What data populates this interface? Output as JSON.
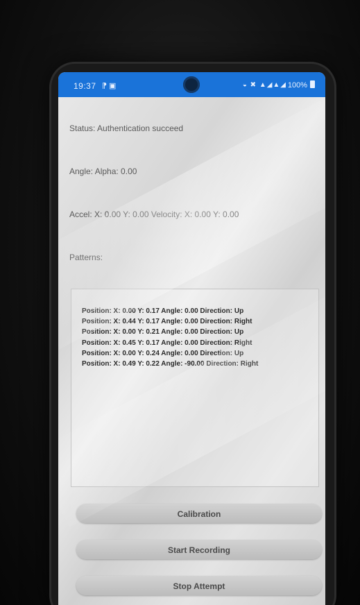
{
  "status_bar": {
    "time": "19:37",
    "left_icons": "⁋ ▣",
    "right_icons": "◒ ✖ ▲◢▲◢",
    "battery": "100%"
  },
  "status": {
    "label": "Status: Authentication succeed"
  },
  "angle": {
    "label": "Angle: Alpha: 0.00"
  },
  "accel": {
    "label": "Accel: X: 0.00 Y: 0.00  Velocity: X: 0.00 Y: 0.00"
  },
  "patterns": {
    "heading": "Patterns:",
    "items": [
      "Position: X: 0.00 Y: 0.17 Angle: 0.00 Direction: Up",
      "Position: X: 0.44 Y: 0.17 Angle: 0.00 Direction: Right",
      "Position: X: 0.00 Y: 0.21 Angle: 0.00 Direction: Up",
      "Position: X: 0.45 Y: 0.17 Angle: 0.00 Direction: Right",
      "Position: X: 0.00 Y: 0.24 Angle: 0.00 Direction: Up",
      "Position: X: 0.49 Y: 0.22 Angle: -90.00 Direction: Right"
    ]
  },
  "buttons": {
    "calibration": "Calibration",
    "start_recording": "Start Recording",
    "stop_attempt": "Stop Attempt"
  },
  "colors": {
    "status_bar": "#1a73d9",
    "button": "#c8c8c8",
    "text": "#5a5a5a"
  }
}
